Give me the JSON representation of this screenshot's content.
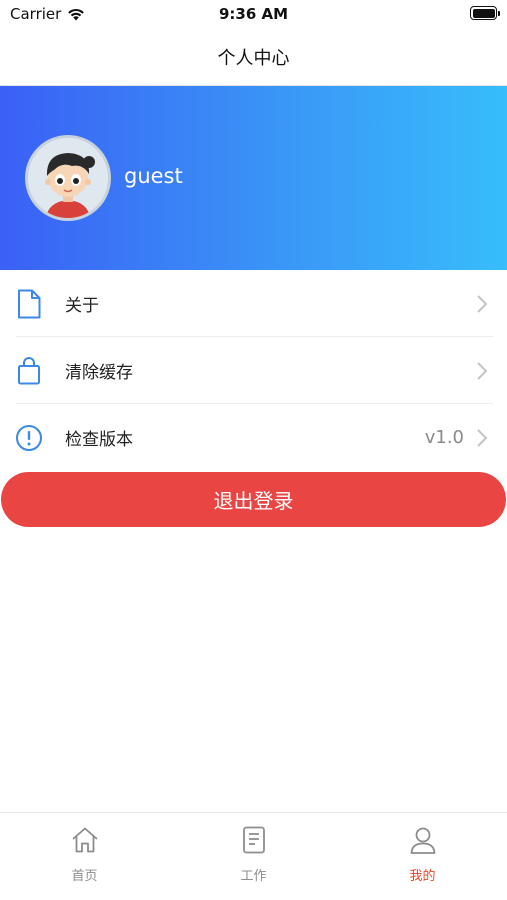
{
  "status_bar": {
    "carrier": "Carrier",
    "time": "9:36 AM",
    "battery_level": 1.0
  },
  "nav": {
    "title": "个人中心"
  },
  "profile": {
    "username": "guest",
    "gradient_start": "#3a60f5",
    "gradient_end": "#37bdfb"
  },
  "menu": {
    "items": [
      {
        "icon": "document-icon",
        "label": "关于",
        "value": ""
      },
      {
        "icon": "bag-icon",
        "label": "清除缓存",
        "value": ""
      },
      {
        "icon": "info-circle-icon",
        "label": "检查版本",
        "value": "v1.0"
      }
    ]
  },
  "logout": {
    "label": "退出登录",
    "color": "#e84543"
  },
  "tabs": {
    "items": [
      {
        "icon": "home-icon",
        "label": "首页",
        "active": false
      },
      {
        "icon": "clipboard-icon",
        "label": "工作",
        "active": false
      },
      {
        "icon": "user-icon",
        "label": "我的",
        "active": true
      }
    ],
    "active_color": "#e84a2b",
    "inactive_color": "#8c8c8c"
  }
}
